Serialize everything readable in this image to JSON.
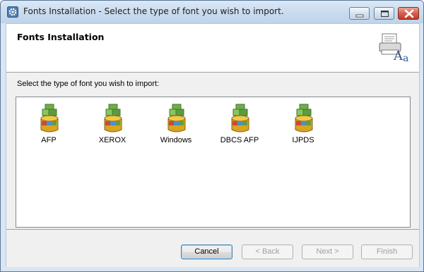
{
  "window": {
    "title": "Fonts Installation - Select the type of font you wish to import.",
    "buttons": {
      "minimize": "minimize-icon",
      "maximize": "maximize-icon",
      "close": "close-icon"
    }
  },
  "header": {
    "title": "Fonts Installation",
    "icon": "printer-font-icon"
  },
  "body": {
    "prompt": "Select the type of font you wish to import:",
    "font_types": [
      {
        "label": "AFP",
        "icon": "font-database-icon"
      },
      {
        "label": "XEROX",
        "icon": "font-database-icon"
      },
      {
        "label": "Windows",
        "icon": "font-database-icon"
      },
      {
        "label": "DBCS AFP",
        "icon": "font-database-icon"
      },
      {
        "label": "IJPDS",
        "icon": "font-database-icon"
      }
    ]
  },
  "footer": {
    "cancel": "Cancel",
    "back": "< Back",
    "next": "Next >",
    "finish": "Finish"
  },
  "colors": {
    "title_bar": "#c9dbef",
    "close_button": "#c23b25",
    "panel": "#f0f0f0"
  }
}
